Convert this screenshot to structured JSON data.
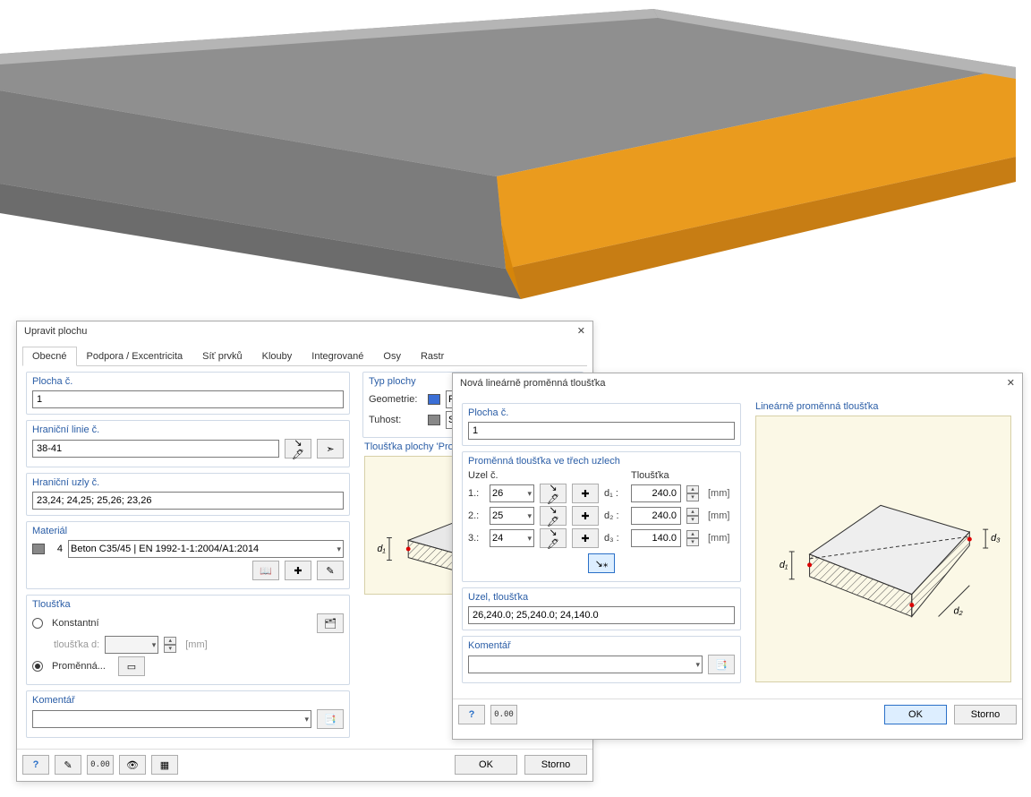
{
  "viewport": {},
  "dialog1": {
    "title": "Upravit plochu",
    "tabs": [
      "Obecné",
      "Podpora / Excentricita",
      "Síť prvků",
      "Klouby",
      "Integrované",
      "Osy",
      "Rastr"
    ],
    "active_tab": 0,
    "group_plocha": {
      "title": "Plocha č.",
      "value": "1"
    },
    "group_linie": {
      "title": "Hraniční linie č.",
      "value": "38-41"
    },
    "group_uzly": {
      "title": "Hraniční uzly č.",
      "value": "23,24; 24,25; 25,26; 23,26"
    },
    "group_material": {
      "title": "Materiál",
      "id": "4",
      "value": "Beton C35/45 | EN 1992-1-1:2004/A1:2014"
    },
    "group_tloustka": {
      "title": "Tloušťka",
      "radio_konst": "Konstantní",
      "thickness_label": "tloušťka d:",
      "thickness_value": "",
      "unit": "[mm]",
      "radio_promenna": "Proměnná..."
    },
    "group_komentar": {
      "title": "Komentář",
      "value": ""
    },
    "group_typ": {
      "title": "Typ plochy",
      "geo_label": "Geometrie:",
      "geo_value": "Rovinná",
      "tuh_label": "Tuhost:",
      "tuh_value": "Standard"
    },
    "group_tloustka_preview": {
      "title": "Tloušťka plochy 'Proměnná'",
      "dim": "d₁"
    },
    "footer": {
      "ok": "OK",
      "cancel": "Storno"
    }
  },
  "dialog2": {
    "title": "Nová lineárně proměnná tloušťka",
    "group_plocha": {
      "title": "Plocha č.",
      "value": "1"
    },
    "group_nodes": {
      "title": "Proměnná tloušťka ve třech uzlech",
      "col_uzel": "Uzel č.",
      "col_tl": "Tloušťka",
      "rows": [
        {
          "n": "1.:",
          "node": "26",
          "dlabel": "d₁ :",
          "value": "240.0"
        },
        {
          "n": "2.:",
          "node": "25",
          "dlabel": "d₂ :",
          "value": "240.0"
        },
        {
          "n": "3.:",
          "node": "24",
          "dlabel": "d₃ :",
          "value": "140.0"
        }
      ],
      "unit": "[mm]"
    },
    "group_uzeltl": {
      "title": "Uzel, tloušťka",
      "value": "26,240.0; 25,240.0; 24,140.0"
    },
    "group_komentar": {
      "title": "Komentář",
      "value": ""
    },
    "preview": {
      "title": "Lineárně proměnná tloušťka",
      "d1": "d₁",
      "d2": "d₂",
      "d3": "d₃"
    },
    "footer": {
      "ok": "OK",
      "cancel": "Storno"
    }
  },
  "icons": {
    "pick": "↖",
    "pointer": "➤",
    "lib": "📖",
    "new": "✚",
    "edit": "✎",
    "copy": "📄",
    "help": "?",
    "measure": "0.00",
    "eye": "👁",
    "graph": "▦",
    "close": "✕"
  }
}
